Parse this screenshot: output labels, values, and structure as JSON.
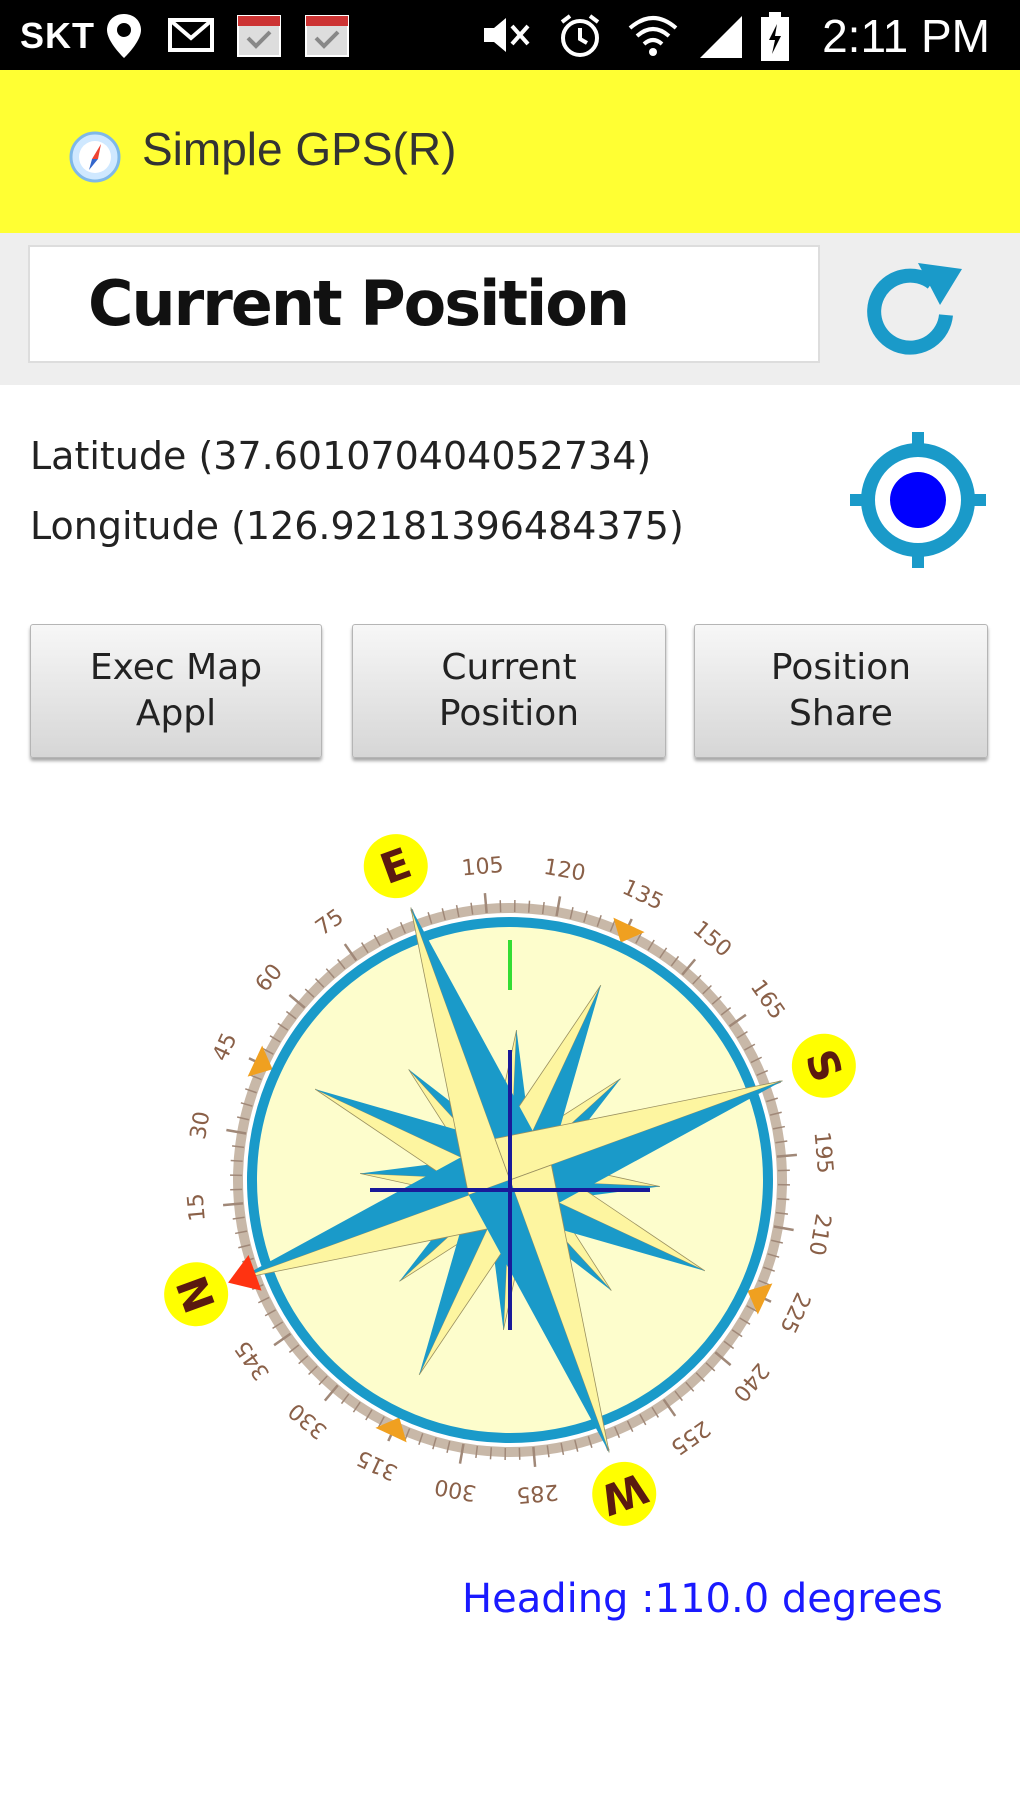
{
  "status_bar": {
    "carrier": "SKT",
    "time": "2:11 PM",
    "icons": [
      "location-pin-icon",
      "mail-icon",
      "calendar-icon",
      "calendar-icon",
      "mute-icon",
      "alarm-icon",
      "wifi-icon",
      "signal-icon",
      "battery-icon"
    ]
  },
  "app": {
    "title": "Simple GPS(R)",
    "accent_color": "#ffff33"
  },
  "header": {
    "title": "Current Position",
    "refresh_icon": "refresh-icon"
  },
  "position": {
    "latitude": "Latitude (37.601070404052734)",
    "longitude": "Longitude (126.92181396484375)",
    "gps_icon": "gps-crosshair-icon"
  },
  "buttons": {
    "exec_map": "Exec Map\nAppl",
    "current_position": "Current\nPosition",
    "position_share": "Position\nShare"
  },
  "compass": {
    "heading_degrees": 110,
    "heading_text": "Heading :110.0 degrees",
    "cardinals": {
      "n": "N",
      "e": "E",
      "s": "S",
      "w": "W"
    },
    "tick_labels": [
      "15",
      "30",
      "45",
      "60",
      "75",
      "105",
      "120",
      "135",
      "150",
      "165",
      "195",
      "210",
      "225",
      "240",
      "255",
      "285",
      "300",
      "315",
      "330",
      "345"
    ]
  }
}
